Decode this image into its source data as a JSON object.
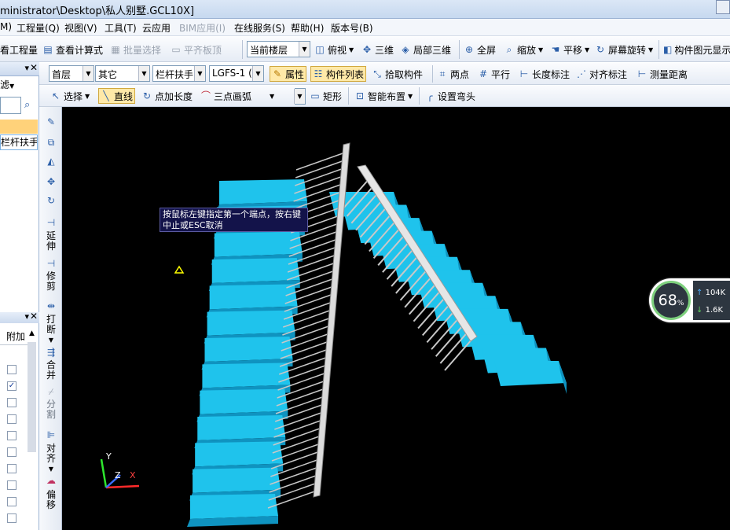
{
  "title": "ministrator\\Desktop\\私人别墅.GCL10X]",
  "menu": [
    {
      "label": "M)",
      "disabled": false
    },
    {
      "label": "工程量(Q)",
      "disabled": false
    },
    {
      "label": "视图(V)",
      "disabled": false
    },
    {
      "label": "工具(T)",
      "disabled": false
    },
    {
      "label": "云应用",
      "disabled": false
    },
    {
      "label": "BIM应用(I)",
      "disabled": true
    },
    {
      "label": "在线服务(S)",
      "disabled": false
    },
    {
      "label": "帮助(H)",
      "disabled": false
    },
    {
      "label": "版本号(B)",
      "disabled": false
    }
  ],
  "toolbar1": {
    "view_qty": "看工程量",
    "view_formula": "查看计算式",
    "batch_select": "批量选择",
    "align_slab": "平齐板顶",
    "floor_combo": "当前楼层",
    "top_view": "俯视",
    "three_d": "三维",
    "local_3d": "局部三维",
    "fullscreen": "全屏",
    "zoom": "缩放",
    "pan": "平移",
    "rotate": "屏幕旋转",
    "show_elements": "构件图元显示"
  },
  "toolbar2": {
    "floor": "首层",
    "category": "其它",
    "type": "栏杆扶手",
    "element": "LGFS-1 (",
    "properties": "属性",
    "element_list": "构件列表",
    "pick_element": "拾取构件",
    "two_points": "两点",
    "parallel": "平行",
    "length_dim": "长度标注",
    "align_dim": "对齐标注",
    "measure": "测量距离"
  },
  "toolbar3": {
    "select": "选择",
    "line": "直线",
    "point_length": "点加长度",
    "three_point_arc": "三点画弧",
    "rect": "矩形",
    "smart_layout": "智能布置",
    "set_bend": "设置弯头"
  },
  "left_panel": {
    "filter_label": "滤",
    "tree_item": "栏杆扶手",
    "table_header": "附加"
  },
  "vtoolbar": {
    "extend": [
      "延",
      "伸"
    ],
    "trim": [
      "修",
      "剪"
    ],
    "break": [
      "打",
      "断"
    ],
    "merge": [
      "合",
      "并"
    ],
    "split": [
      "分",
      "割"
    ],
    "align": [
      "对",
      "齐"
    ],
    "offset": [
      "偏",
      "移"
    ]
  },
  "tooltip": "按鼠标左键指定第一个端点，按右键中止或ESC取消",
  "gauge": {
    "percent": "68",
    "unit": "%",
    "up": "104K",
    "down": "1.6K"
  },
  "axes": {
    "x": "X",
    "y": "Y",
    "z": "Z"
  },
  "colors": {
    "stair": "#1fc3ec",
    "stair_side": "#0f93c0",
    "rail": "#c8c8c8",
    "canvas": "#000000"
  }
}
